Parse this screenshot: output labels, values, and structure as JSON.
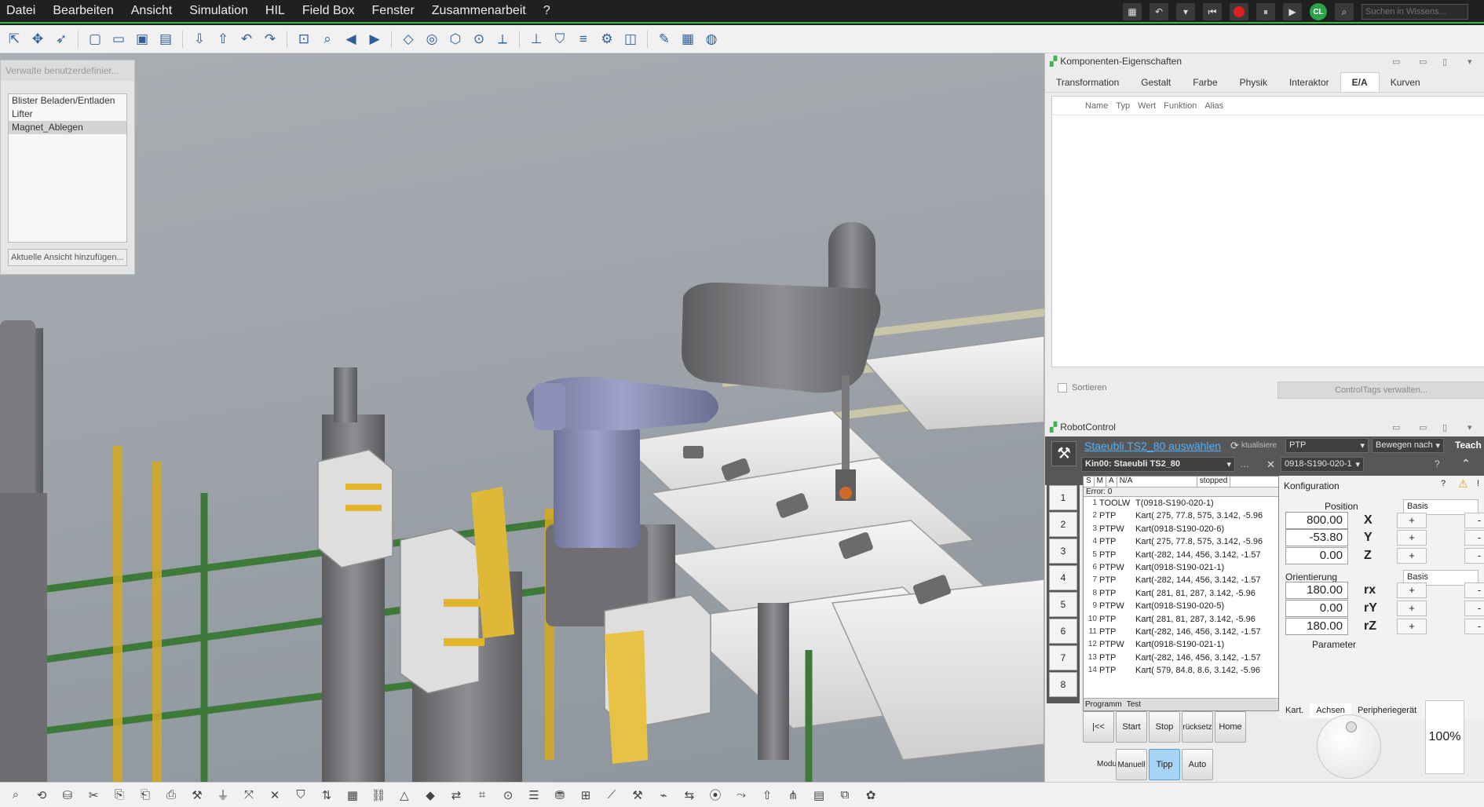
{
  "menu": {
    "items": [
      "Datei",
      "Bearbeiten",
      "Ansicht",
      "Simulation",
      "HIL",
      "Field Box",
      "Fenster",
      "Zusammenarbeit",
      "?"
    ]
  },
  "titlebar": {
    "search_placeholder": "Suchen in Wissens...",
    "user_initials": "CL"
  },
  "toolbar": {
    "icons": [
      "select-icon",
      "move-icon",
      "pick-icon",
      "new-icon",
      "open-icon",
      "save-icon",
      "save-all-icon",
      "import-icon",
      "export-icon",
      "undo-icon",
      "redo-icon",
      "zoom-fit-icon",
      "zoom-icon",
      "arrow-left-icon",
      "arrow-right-icon",
      "box-icon",
      "sphere-icon",
      "cube-icon",
      "snap-icon",
      "measure-icon",
      "axis-icon",
      "shield-icon",
      "align-icon",
      "gear-icon",
      "camera-icon",
      "pen-icon",
      "layout-icon",
      "globe-icon"
    ]
  },
  "views": {
    "header": "Verwalte benutzerdefinier...",
    "items": [
      "Blister Beladen/Entladen",
      "Lifter",
      "Magnet_Ablegen"
    ],
    "add_button": "Aktuelle Ansicht hinzufügen..."
  },
  "props": {
    "title": "Komponenten-Eigenschaften",
    "tabs": [
      "Transformation",
      "Gestalt",
      "Farbe",
      "Physik",
      "Interaktor",
      "E/A",
      "Kurven"
    ],
    "active_tab": "E/A",
    "columns": [
      "Name",
      "Typ",
      "Wert",
      "Funktion",
      "Alias"
    ],
    "sort_label": "Sortieren",
    "ctrl_tags_button": "ControlTags verwalten..."
  },
  "robot": {
    "title": "RobotControl",
    "robot_link": "Staeubli TS2_80 auswählen",
    "update_label": "ktualisiere",
    "motion_type": "PTP",
    "move_to": "Bewegen nach",
    "teach": "Teach",
    "robot_name": "Kin00: Staeubli TS2_80",
    "target": "0918-S190-020-1",
    "status_cells": [
      "S",
      "M",
      "A",
      "N/A",
      "stopped"
    ],
    "error": "Error: 0",
    "program_label": "Programm",
    "program_name": "Test",
    "side_numbers": [
      "1",
      "2",
      "3",
      "4",
      "5",
      "6",
      "7",
      "8"
    ],
    "lines": [
      {
        "n": "1",
        "cmd": "TOOLW",
        "args": "T(0918-S190-020-1)"
      },
      {
        "n": "2",
        "cmd": "PTP",
        "args": "Kart( 275, 77.8, 575, 3.142, -5.96"
      },
      {
        "n": "3",
        "cmd": "PTPW",
        "args": "Kart(0918-S190-020-6)"
      },
      {
        "n": "4",
        "cmd": "PTP",
        "args": "Kart( 275, 77.8, 575, 3.142, -5.96"
      },
      {
        "n": "5",
        "cmd": "PTP",
        "args": "Kart(-282, 144, 456, 3.142, -1.57"
      },
      {
        "n": "6",
        "cmd": "PTPW",
        "args": "Kart(0918-S190-021-1)"
      },
      {
        "n": "7",
        "cmd": "PTP",
        "args": "Kart(-282, 144, 456, 3.142, -1.57"
      },
      {
        "n": "8",
        "cmd": "PTP",
        "args": "Kart( 281, 81, 287, 3.142, -5.96"
      },
      {
        "n": "9",
        "cmd": "PTPW",
        "args": "Kart(0918-S190-020-5)"
      },
      {
        "n": "10",
        "cmd": "PTP",
        "args": "Kart( 281, 81, 287, 3.142, -5.96"
      },
      {
        "n": "11",
        "cmd": "PTP",
        "args": "Kart(-282, 146, 456, 3.142, -1.57"
      },
      {
        "n": "12",
        "cmd": "PTPW",
        "args": "Kart(0918-S190-021-1)"
      },
      {
        "n": "13",
        "cmd": "PTP",
        "args": "Kart(-282, 146, 456, 3.142, -1.57"
      },
      {
        "n": "14",
        "cmd": "PTP",
        "args": "Kart( 579, 84.8, 8.6, 3.142, -5.96"
      }
    ],
    "config": {
      "title": "Konfiguration",
      "position_label": "Position",
      "position_frame": "Basis",
      "orientation_label": "Orientierung",
      "orientation_frame": "Basis",
      "parameter_label": "Parameter",
      "axes": [
        {
          "label": "X",
          "value": "800.00"
        },
        {
          "label": "Y",
          "value": "-53.80"
        },
        {
          "label": "Z",
          "value": "0.00"
        },
        {
          "label": "rx",
          "value": "180.00"
        },
        {
          "label": "rY",
          "value": "0.00"
        },
        {
          "label": "rZ",
          "value": "180.00"
        }
      ],
      "tabs": [
        "Kart.",
        "Achsen",
        "Peripheriegerät"
      ],
      "plus": "+",
      "minus": "-"
    },
    "buttons": {
      "rewind": "|<<",
      "start": "Start",
      "stop": "Stop",
      "reset": "rücksetz",
      "home": "Home",
      "mode": "Modus",
      "manual": "Manuell",
      "jog": "Tipp",
      "auto": "Auto"
    },
    "speed": "100%"
  },
  "statusbar": {
    "icons": [
      "zoom-icon",
      "rotate-icon",
      "db-icon",
      "cut-icon",
      "copy-icon",
      "paste-icon",
      "print-icon",
      "config-icon",
      "filter-icon",
      "transform-icon",
      "close-icon",
      "bucket-icon",
      "sort-icon",
      "grid-icon",
      "link-icon",
      "triangle-icon",
      "shape-icon",
      "connect-icon",
      "frame-icon",
      "snap-icon",
      "list-icon",
      "drive-icon",
      "table-icon",
      "chart-icon",
      "robot-icon",
      "signal-icon",
      "io-icon",
      "sensor-icon",
      "path-icon",
      "export-icon",
      "graph-icon",
      "terminal-icon",
      "layers-icon",
      "palette-icon"
    ]
  },
  "colors": {
    "accent": "#3ab54a",
    "link": "#4fb0ff",
    "active_button": "#a6d4f5",
    "viewport_bg": "#a3a9ae",
    "robot_gray": "#7d7d80",
    "robot_blue": "#8a8fb8",
    "frame_green": "#3d7a3a",
    "frame_yellow": "#d4a820"
  }
}
